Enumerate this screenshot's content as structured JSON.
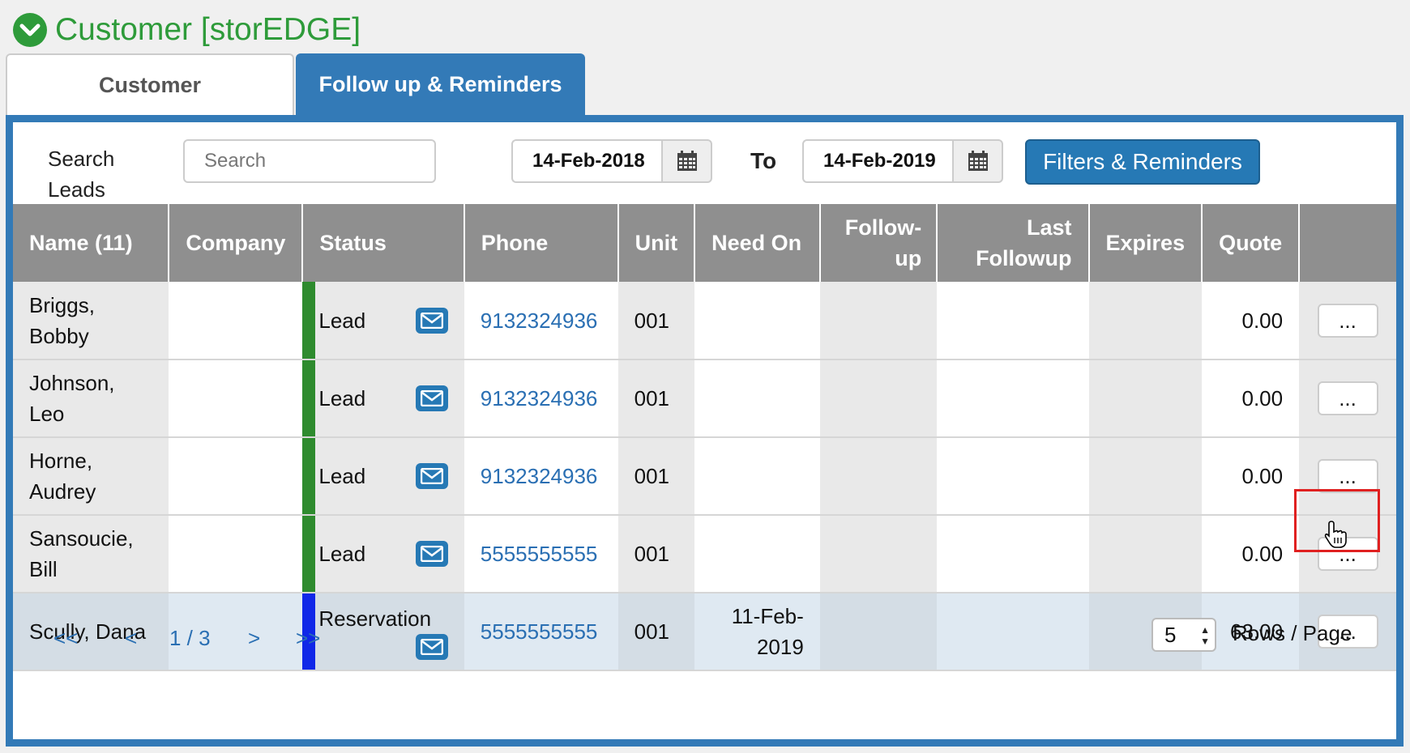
{
  "header": {
    "title": "Customer [storEDGE]",
    "icon": "chevron-down-circle-icon",
    "color": "#2e9b3a"
  },
  "tabs": [
    {
      "label": "Customer",
      "active": false
    },
    {
      "label": "Follow up & Reminders",
      "active": true
    }
  ],
  "toolbar": {
    "search_label_line1": "Search",
    "search_label_line2": "Leads",
    "search_placeholder": "Search",
    "date_from": "14-Feb-2018",
    "to_label": "To",
    "date_to": "14-Feb-2019",
    "filters_button": "Filters & Reminders"
  },
  "table": {
    "headers": [
      "Name (11)",
      "Company",
      "Status",
      "Phone",
      "Unit",
      "Need On",
      "Follow-up",
      "Last Followup",
      "Expires",
      "Quote",
      ""
    ],
    "more_label": "...",
    "rows": [
      {
        "name_line1": "Briggs,",
        "name_line2": "Bobby",
        "company": "",
        "status": "Lead",
        "status_color": "#2e8b2e",
        "phone": "9132324936",
        "unit": "001",
        "need_on_line1": "",
        "need_on_line2": "",
        "followup": "",
        "last_followup": "",
        "expires": "",
        "quote": "0.00"
      },
      {
        "name_line1": "Johnson,",
        "name_line2": "Leo",
        "company": "",
        "status": "Lead",
        "status_color": "#2e8b2e",
        "phone": "9132324936",
        "unit": "001",
        "need_on_line1": "",
        "need_on_line2": "",
        "followup": "",
        "last_followup": "",
        "expires": "",
        "quote": "0.00"
      },
      {
        "name_line1": "Horne,",
        "name_line2": "Audrey",
        "company": "",
        "status": "Lead",
        "status_color": "#2e8b2e",
        "phone": "9132324936",
        "unit": "001",
        "need_on_line1": "",
        "need_on_line2": "",
        "followup": "",
        "last_followup": "",
        "expires": "",
        "quote": "0.00"
      },
      {
        "name_line1": "Sansoucie,",
        "name_line2": "Bill",
        "company": "",
        "status": "Lead",
        "status_color": "#2e8b2e",
        "phone": "5555555555",
        "unit": "001",
        "need_on_line1": "",
        "need_on_line2": "",
        "followup": "",
        "last_followup": "",
        "expires": "",
        "quote": "0.00"
      },
      {
        "name_line1": "Scully, Dana",
        "name_line2": "",
        "company": "",
        "status": "Reservation",
        "status_color": "#1027e8",
        "phone": "5555555555",
        "unit": "001",
        "need_on_line1": "11-Feb-",
        "need_on_line2": "2019",
        "followup": "",
        "last_followup": "",
        "expires": "",
        "quote": "63.00"
      }
    ]
  },
  "pager": {
    "first": "<<",
    "prev": "<",
    "page": "1 / 3",
    "next": ">",
    "last": ">>"
  },
  "rows_per_page": {
    "value": "5",
    "label": "Rows / Page"
  },
  "colors": {
    "accent": "#337ab7",
    "button": "#2679b5",
    "link": "#2a6fb3",
    "header_bg": "#8f8f8f"
  }
}
